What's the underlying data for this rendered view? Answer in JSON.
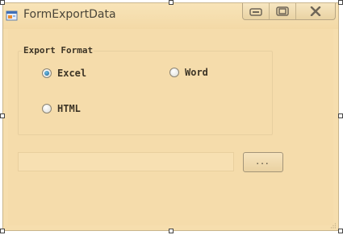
{
  "window": {
    "title": "FormExportData",
    "caption_buttons": {
      "minimize_icon": "minimize-icon",
      "maximize_icon": "maximize-icon",
      "close_icon": "close-icon"
    }
  },
  "export_group": {
    "label": "Export Format",
    "options": [
      {
        "label": "Excel",
        "checked": true
      },
      {
        "label": "Word",
        "checked": false
      },
      {
        "label": "HTML",
        "checked": false
      }
    ]
  },
  "path_input": {
    "value": "",
    "placeholder": ""
  },
  "browse_button": {
    "label": "..."
  },
  "colors": {
    "client_background": "#f5dcab",
    "title_text": "#4a4538",
    "radio_selected": "#1c5f90"
  }
}
